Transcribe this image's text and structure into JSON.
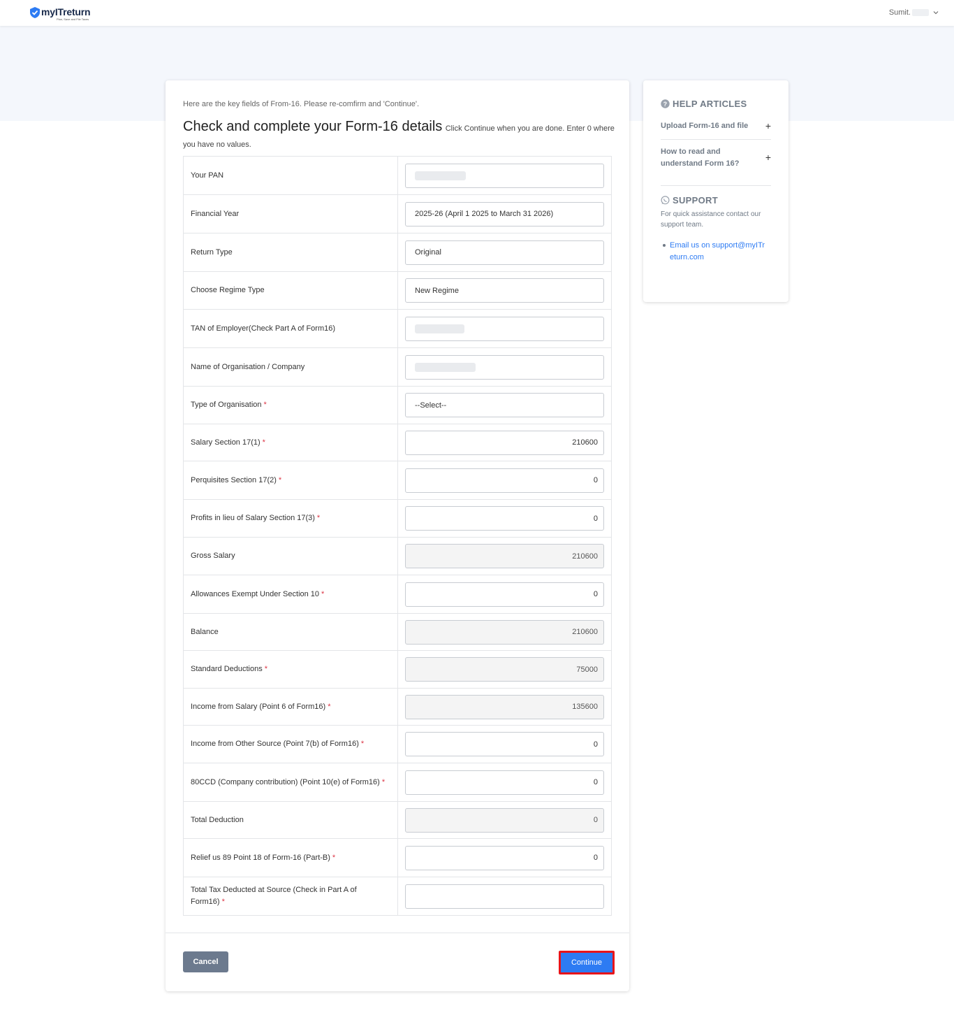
{
  "header": {
    "logo_name": "myITreturn",
    "logo_tagline": "Plan, Save and File Taxes",
    "user_name": "Sumit."
  },
  "form": {
    "intro": "Here are the key fields of From-16. Please re-comfirm and 'Continue'.",
    "title": "Check and complete your Form-16 details",
    "subtitle": "Click Continue when you are done. Enter 0 where you have no values.",
    "rows": [
      {
        "label": "Your PAN",
        "value": ""
      },
      {
        "label": "Financial Year",
        "value": "2025-26 (April 1 2025 to March 31 2026)"
      },
      {
        "label": "Return Type",
        "value": "Original"
      },
      {
        "label": "Choose Regime Type",
        "value": "New Regime"
      },
      {
        "label": "TAN of Employer(Check Part A of Form16)",
        "value": ""
      },
      {
        "label": "Name of Organisation / Company",
        "value": ""
      },
      {
        "label": "Type of Organisation",
        "value": "--Select--"
      },
      {
        "label": "Salary Section 17(1)",
        "value": "210600"
      },
      {
        "label": "Perquisites Section 17(2)",
        "value": "0"
      },
      {
        "label": "Profits in lieu of Salary Section 17(3)",
        "value": "0"
      },
      {
        "label": "Gross Salary",
        "value": "210600"
      },
      {
        "label": "Allowances Exempt Under Section 10",
        "value": "0"
      },
      {
        "label": "Balance",
        "value": "210600"
      },
      {
        "label": "Standard Deductions",
        "value": "75000"
      },
      {
        "label": "Income from Salary (Point 6 of Form16)",
        "value": "135600"
      },
      {
        "label": "Income from Other Source (Point 7(b) of Form16)",
        "value": "0"
      },
      {
        "label": "80CCD (Company contribution) (Point 10(e) of Form16)",
        "value": "0"
      },
      {
        "label": "Total Deduction",
        "value": "0"
      },
      {
        "label": "Relief us 89 Point 18 of Form-16 (Part-B)",
        "value": "0"
      },
      {
        "label": "Total Tax Deducted at Source (Check in Part A of Form16)",
        "value": ""
      }
    ],
    "required_marker": "*",
    "cancel_label": "Cancel",
    "continue_label": "Continue"
  },
  "sidebar": {
    "help_title": "HELP ARTICLES",
    "help_items": [
      {
        "label": "Upload Form-16 and file"
      },
      {
        "label": "How to read and understand Form 16?"
      }
    ],
    "plus_glyph": "+",
    "support_title": "SUPPORT",
    "support_text": "For quick assistance contact our support team.",
    "support_link": "Email us on support@myITreturn.com"
  },
  "colors": {
    "accent": "#2d7bf3",
    "required": "#dc3545",
    "highlight_border": "#e8141a",
    "cancel": "#6c7a8e"
  }
}
